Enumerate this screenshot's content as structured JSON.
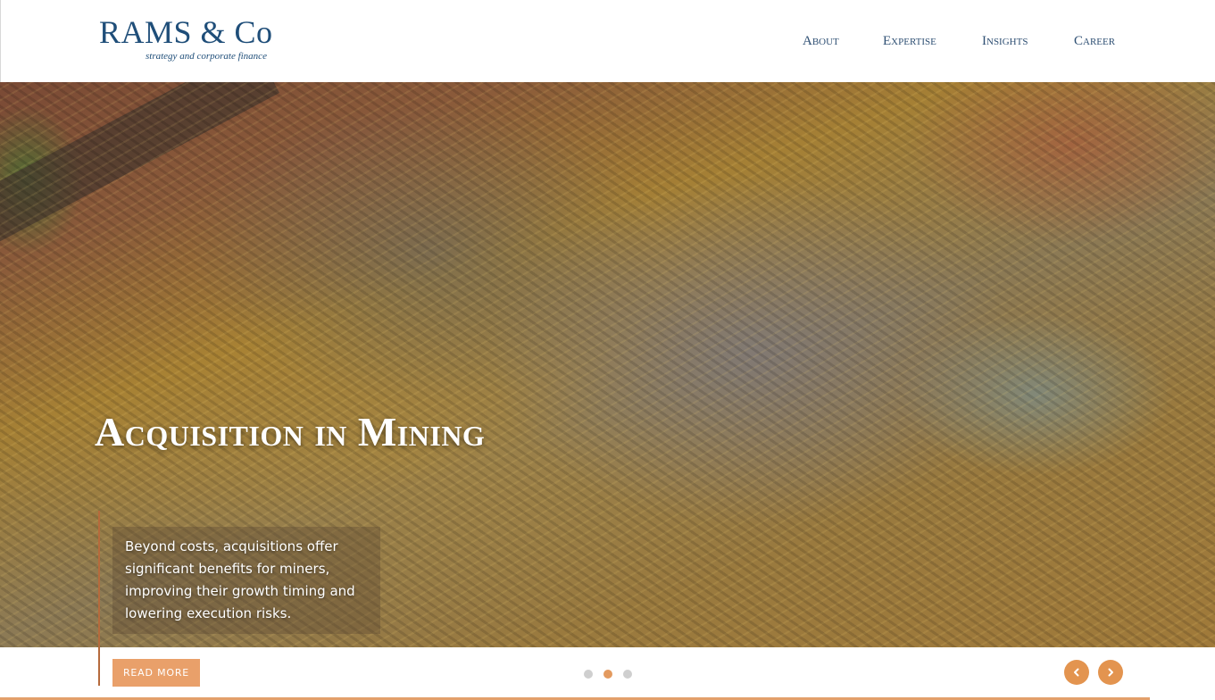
{
  "brand": {
    "name": "RAMS & Co",
    "tagline": "strategy and corporate finance"
  },
  "nav": {
    "items": [
      {
        "label": "About"
      },
      {
        "label": "Expertise"
      },
      {
        "label": "Insights"
      },
      {
        "label": "Career"
      }
    ]
  },
  "hero": {
    "title": "Acquisition in Mining",
    "description": "Beyond costs, acquisitions offer significant benefits for miners, improving their growth timing and lowering execution risks.",
    "read_more_label": "READ MORE"
  },
  "carousel": {
    "slide_count": 3,
    "active_index": 1,
    "prev_icon": "chevron-left-icon",
    "next_icon": "chevron-right-icon"
  },
  "colors": {
    "brand_blue": "#1f4e79",
    "accent_orange": "#e3944f",
    "button_orange": "#e9a06a"
  }
}
